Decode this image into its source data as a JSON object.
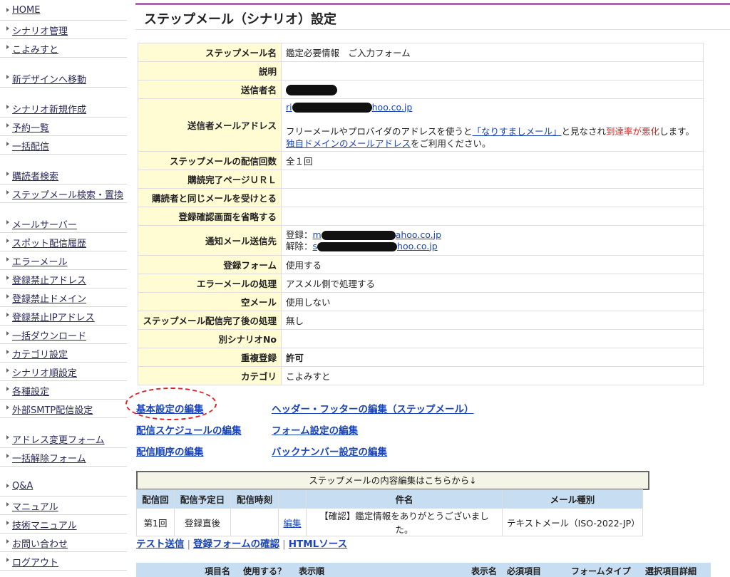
{
  "sidebar": {
    "items": [
      {
        "label": "HOME"
      },
      {
        "label": "シナリオ管理"
      },
      {
        "label": "こよみすと"
      },
      {
        "label": "新デザインへ移動"
      },
      {
        "label": "シナリオ新規作成"
      },
      {
        "label": "予約一覧"
      },
      {
        "label": "一括配信"
      },
      {
        "label": "購読者検索"
      },
      {
        "label": "ステップメール検索・置換"
      },
      {
        "label": "メールサーバー"
      },
      {
        "label": "スポット配信履歴"
      },
      {
        "label": "エラーメール"
      },
      {
        "label": "登録禁止アドレス"
      },
      {
        "label": "登録禁止ドメイン"
      },
      {
        "label": "登録禁止IPアドレス"
      },
      {
        "label": "一括ダウンロード"
      },
      {
        "label": "カテゴリ設定"
      },
      {
        "label": "シナリオ順設定"
      },
      {
        "label": "各種設定"
      },
      {
        "label": "外部SMTP配信設定"
      },
      {
        "label": "アドレス変更フォーム"
      },
      {
        "label": "一括解除フォーム"
      },
      {
        "label": "Q&A"
      },
      {
        "label": "マニュアル"
      },
      {
        "label": "技術マニュアル"
      },
      {
        "label": "お問い合わせ"
      },
      {
        "label": "ログアウト"
      }
    ]
  },
  "page": {
    "title": "ステップメール（シナリオ）設定"
  },
  "settings": {
    "step_name_label": "ステップメール名",
    "step_name_value": "鑑定必要情報　ご入力フォーム",
    "description_label": "説明",
    "sender_name_label": "送信者名",
    "sender_email_label": "送信者メールアドレス",
    "sender_email_prefix": "ri",
    "sender_email_suffix": "hoo.co.jp",
    "sender_note_1": "フリーメールやプロバイダのアドレスを使うと",
    "sender_note_link": "「なりすましメール」",
    "sender_note_2": "と見なされ",
    "sender_note_red": "到達率が悪化",
    "sender_note_3": "します。",
    "sender_note_link2": "独自ドメインのメールアドレス",
    "sender_note_4": "をご利用ください。",
    "delivery_count_label": "ステップメールの配信回数",
    "delivery_count_value": "全１回",
    "purchase_url_label": "購読完了ページＵＲＬ",
    "same_mail_label": "購読者と同じメールを受けとる",
    "skip_confirm_label": "登録確認画面を省略する",
    "notify_label": "通知メール送信先",
    "notify_reg_prefix": "登録：",
    "notify_reg_frag_a": "m",
    "notify_reg_frag_b": "ahoo.co.jp",
    "notify_unreg_prefix": "解除：",
    "notify_unreg_frag_a": "s",
    "notify_unreg_frag_b": "hoo.co.jp",
    "reg_form_label": "登録フォーム",
    "reg_form_value": "使用する",
    "error_mail_label": "エラーメールの処理",
    "error_mail_value": "アスメル側で処理する",
    "empty_mail_label": "空メール",
    "empty_mail_value": "使用しない",
    "after_complete_label": "ステップメール配信完了後の処理",
    "after_complete_value": "無し",
    "other_scenario_label": "別シナリオNo",
    "duplicate_label": "重複登録",
    "duplicate_value": "許可",
    "category_label": "カテゴリ",
    "category_value": "こよみすと"
  },
  "links": {
    "basic": "基本設定の編集",
    "header_footer": "ヘッダー・フッターの編集（ステップメール）",
    "schedule": "配信スケジュールの編集",
    "form": "フォーム設定の編集",
    "order": "配信順序の編集",
    "backnumber": "バックナンバー設定の編集"
  },
  "schedule_table": {
    "banner": "ステップメールの内容編集はこちらから↓",
    "headers": [
      "配信回",
      "配信予定日",
      "配信時刻",
      "",
      "件名",
      "メール種別"
    ],
    "row": {
      "num": "第1回",
      "date": "登録直後",
      "time": "",
      "edit": "編集",
      "subject": "【確認】鑑定情報をありがとうございました。",
      "type": "テキストメール（ISO-2022-JP）"
    }
  },
  "bottom_links": {
    "test": "テスト送信",
    "confirm": "登録フォームの確認",
    "html": "HTMLソース",
    "sep": "|"
  },
  "next_table": {
    "headers": [
      "項目名",
      "使用する？",
      "表示順",
      "表示名",
      "必須項目",
      "フォームタイプ",
      "選択項目詳細"
    ]
  }
}
